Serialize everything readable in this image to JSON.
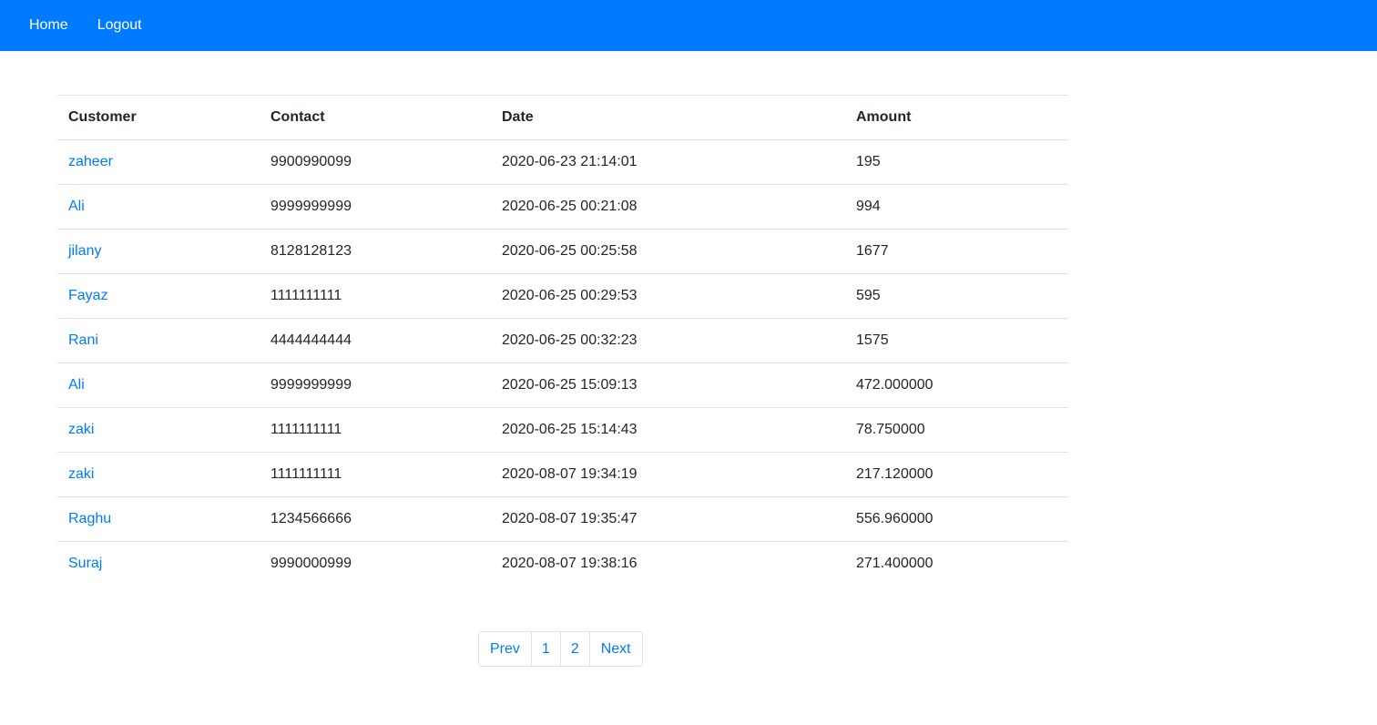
{
  "nav": {
    "home_label": "Home",
    "logout_label": "Logout"
  },
  "colors": {
    "navbar": "#007bff",
    "link": "#007bff",
    "border": "#dee2e6"
  },
  "table": {
    "headers": {
      "customer": "Customer",
      "contact": "Contact",
      "date": "Date",
      "amount": "Amount"
    },
    "rows": [
      {
        "customer": "zaheer",
        "contact": "9900990099",
        "date": "2020-06-23 21:14:01",
        "amount": "195"
      },
      {
        "customer": "Ali",
        "contact": "9999999999",
        "date": "2020-06-25 00:21:08",
        "amount": "994"
      },
      {
        "customer": "jilany",
        "contact": "8128128123",
        "date": "2020-06-25 00:25:58",
        "amount": "1677"
      },
      {
        "customer": "Fayaz",
        "contact": "1111111111",
        "date": "2020-06-25 00:29:53",
        "amount": "595"
      },
      {
        "customer": "Rani",
        "contact": "4444444444",
        "date": "2020-06-25 00:32:23",
        "amount": "1575"
      },
      {
        "customer": "Ali",
        "contact": "9999999999",
        "date": "2020-06-25 15:09:13",
        "amount": "472.000000"
      },
      {
        "customer": "zaki",
        "contact": "1111111111",
        "date": "2020-06-25 15:14:43",
        "amount": "78.750000"
      },
      {
        "customer": "zaki",
        "contact": "1111111111",
        "date": "2020-08-07 19:34:19",
        "amount": "217.120000"
      },
      {
        "customer": "Raghu",
        "contact": "1234566666",
        "date": "2020-08-07 19:35:47",
        "amount": "556.960000"
      },
      {
        "customer": "Suraj",
        "contact": "9990000999",
        "date": "2020-08-07 19:38:16",
        "amount": "271.400000"
      }
    ]
  },
  "pagination": {
    "prev_label": "Prev",
    "pages": [
      "1",
      "2"
    ],
    "next_label": "Next"
  }
}
